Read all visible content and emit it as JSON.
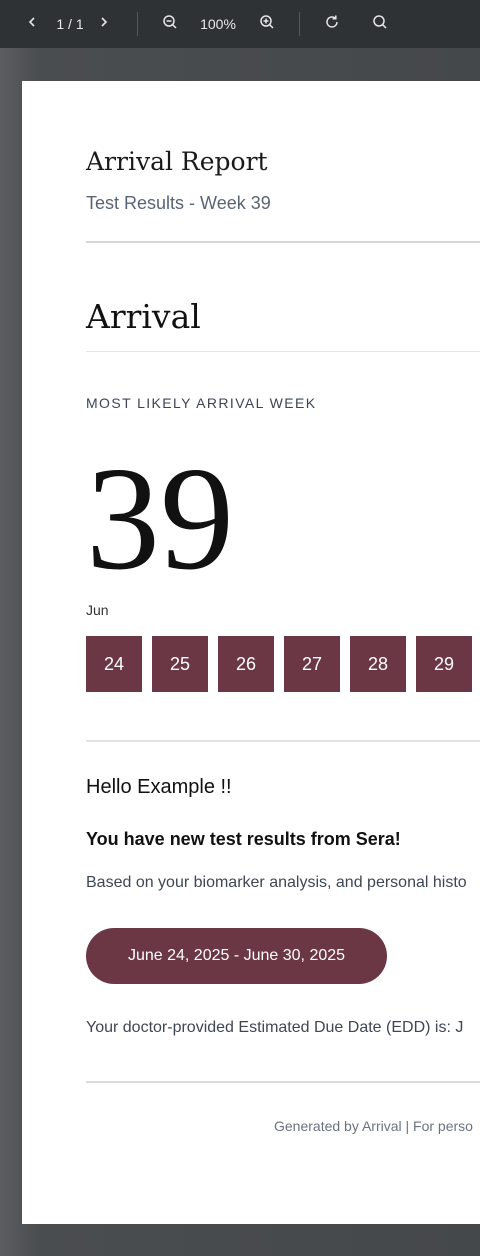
{
  "toolbar": {
    "page_indicator": "1 / 1",
    "zoom_level": "100%",
    "icons": [
      "chevron-left-icon",
      "chevron-right-icon",
      "zoom-out-icon",
      "zoom-in-icon",
      "rotate-icon",
      "search-icon"
    ]
  },
  "report": {
    "title": "Arrival Report",
    "subtitle": "Test Results - Week 39",
    "section_heading": "Arrival",
    "likely_week_label": "MOST LIKELY ARRIVAL WEEK",
    "week_number": "39",
    "month": "Jun",
    "days": [
      "24",
      "25",
      "26",
      "27",
      "28",
      "29"
    ],
    "greeting": "Hello Example !!",
    "new_results": "You have new test results from Sera!",
    "based_text": "Based on your biomarker analysis, and personal histo",
    "date_range": "June 24, 2025 - June 30, 2025",
    "edd_text": "Your doctor-provided Estimated Due Date (EDD) is: J",
    "footer": "Generated by Arrival | For perso"
  },
  "colors": {
    "accent": "#6c3744",
    "toolbar_bg": "#2f3235",
    "backdrop": "#4a4d50"
  }
}
